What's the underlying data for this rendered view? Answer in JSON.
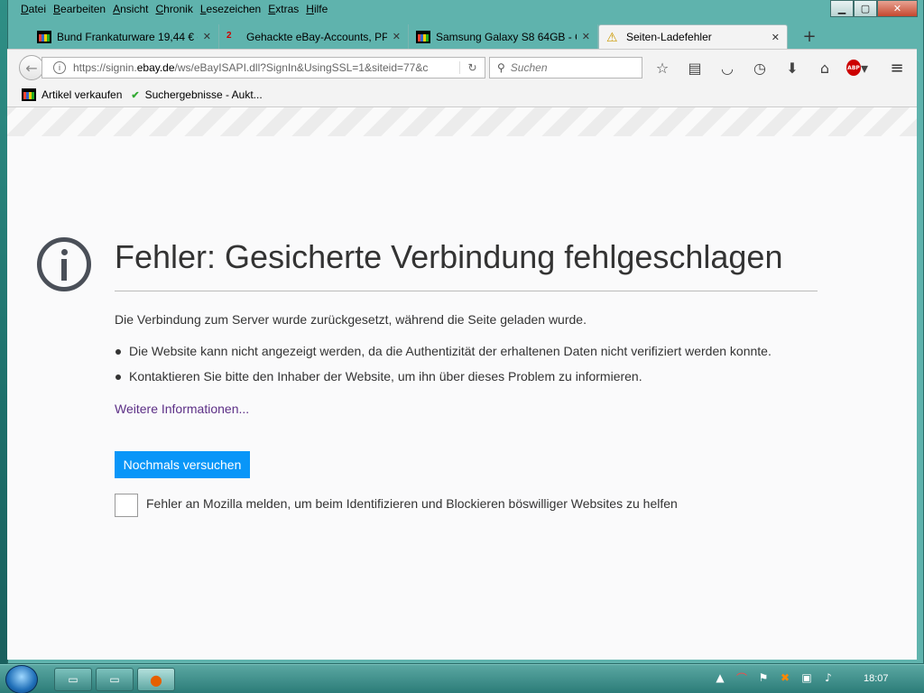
{
  "menu": [
    "Datei",
    "Bearbeiten",
    "Ansicht",
    "Chronik",
    "Lesezeichen",
    "Extras",
    "Hilfe"
  ],
  "tabs": [
    {
      "label": "Bund Frankaturware 19,44 € c",
      "icon": "shopping-bag-icon"
    },
    {
      "label": "Gehackte eBay-Accounts, PP",
      "icon": "notification-badge-icon",
      "badge": "2"
    },
    {
      "label": "Samsung Galaxy S8 64GB - O",
      "icon": "shopping-bag-icon"
    },
    {
      "label": "Seiten-Ladefehler",
      "icon": "warning-icon"
    }
  ],
  "active_tab": 3,
  "new_tab_label": "+",
  "navbar": {
    "url_prefix": "https://signin.",
    "url_domain": "ebay.de",
    "url_suffix": "/ws/eBayISAPI.dll?SignIn&UsingSSL=1&siteid=77&c",
    "search_placeholder": "Suchen"
  },
  "bookmarks": [
    {
      "label": "Artikel verkaufen",
      "icon": "shopping-bag-icon"
    },
    {
      "label": "Suchergebnisse - Aukt...",
      "icon": "auction-icon"
    }
  ],
  "error": {
    "title": "Fehler: Gesicherte Verbindung fehlgeschlagen",
    "description": "Die Verbindung zum Server wurde zurückgesetzt, während die Seite geladen wurde.",
    "bullets": [
      "Die Website kann nicht angezeigt werden, da die Authentizität der erhaltenen Daten nicht verifiziert werden konnte.",
      "Kontaktieren Sie bitte den Inhaber der Website, um ihn über dieses Problem zu informieren."
    ],
    "more_info": "Weitere Informationen...",
    "retry_button": "Nochmals versuchen",
    "report_label": "Fehler an Mozilla melden, um beim Identifizieren und Blockieren böswilliger Websites zu helfen",
    "report_checked": false
  },
  "abp_label": "ABP",
  "clock": "18:07",
  "colors": {
    "retry_button": "#0996f8",
    "link": "#5c2f86",
    "taskbar": "#3d8985"
  }
}
